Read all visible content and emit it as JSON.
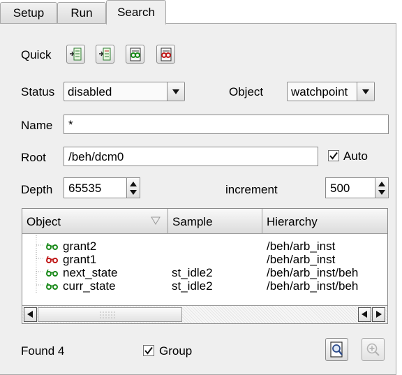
{
  "tabs": [
    {
      "label": "Setup",
      "active": false
    },
    {
      "label": "Run",
      "active": false
    },
    {
      "label": "Search",
      "active": true
    }
  ],
  "quick": {
    "label": "Quick",
    "buttons": [
      "add-signal-icon",
      "add-hierarchy-icon",
      "enable-watch-icon",
      "disable-watch-icon"
    ]
  },
  "status": {
    "label": "Status",
    "value": "disabled"
  },
  "object": {
    "label": "Object",
    "value": "watchpoint"
  },
  "name": {
    "label": "Name",
    "value": "*"
  },
  "root": {
    "label": "Root",
    "value": "/beh/dcm0"
  },
  "auto": {
    "label": "Auto",
    "checked": true
  },
  "depth": {
    "label": "Depth",
    "value": "65535"
  },
  "increment": {
    "label": "increment",
    "value": "500"
  },
  "table": {
    "columns": [
      "Object",
      "Sample",
      "Hierarchy"
    ],
    "rows": [
      {
        "object": "grant2",
        "sample": "",
        "hierarchy": "/beh/arb_inst",
        "icon_color": "#1a8a1a"
      },
      {
        "object": "grant1",
        "sample": "",
        "hierarchy": "/beh/arb_inst",
        "icon_color": "#c01818"
      },
      {
        "object": "next_state",
        "sample": "st_idle2",
        "hierarchy": "/beh/arb_inst/beh",
        "icon_color": "#1a8a1a"
      },
      {
        "object": "curr_state",
        "sample": "st_idle2",
        "hierarchy": "/beh/arb_inst/beh",
        "icon_color": "#1a8a1a"
      }
    ]
  },
  "footer": {
    "found": "Found 4",
    "group_label": "Group",
    "group_checked": true
  }
}
